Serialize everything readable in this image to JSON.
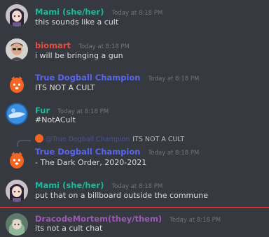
{
  "colors": {
    "background": "#36393f",
    "mami": "#1abc9c",
    "biomart": "#e74c3c",
    "true_dogball": "#5865f2",
    "fur": "#1abc9c",
    "dracode": "#9b59b6",
    "new_messages_divider": "#ed4245"
  },
  "messages": [
    {
      "username": "Mami (she/her)",
      "timestamp": "Today at 8:18 PM",
      "content": "this sounds like a cult",
      "avatar": "avatar-mami"
    },
    {
      "username": "biomart",
      "timestamp": "Today at 8:18 PM",
      "content": "i will be bringing a gun",
      "avatar": "avatar-biomart"
    },
    {
      "username": "True Dogball Champion",
      "timestamp": "Today at 8:18 PM",
      "content": "ITS NOT A CULT",
      "avatar": "avatar-dogball"
    },
    {
      "username": "Fur",
      "timestamp": "Today at 8:18 PM",
      "content": "#NotACult",
      "avatar": "avatar-fur"
    },
    {
      "reply_to_username": "@True Dogball Champion",
      "reply_to_text": "ITS NOT A CULT",
      "username": "True Dogball Champion",
      "timestamp": "Today at 8:18 PM",
      "content": "- The Dark Order, 2020-2021",
      "avatar": "avatar-dogball"
    },
    {
      "username": "Mami (she/her)",
      "timestamp": "Today at 8:18 PM",
      "content": "put that on a billboard outside the commune",
      "avatar": "avatar-mami"
    },
    {
      "username": "DracodeMortem(they/them)",
      "timestamp": "Today at 8:18 PM",
      "content": "its not a cult chat",
      "avatar": "avatar-dracode"
    }
  ]
}
